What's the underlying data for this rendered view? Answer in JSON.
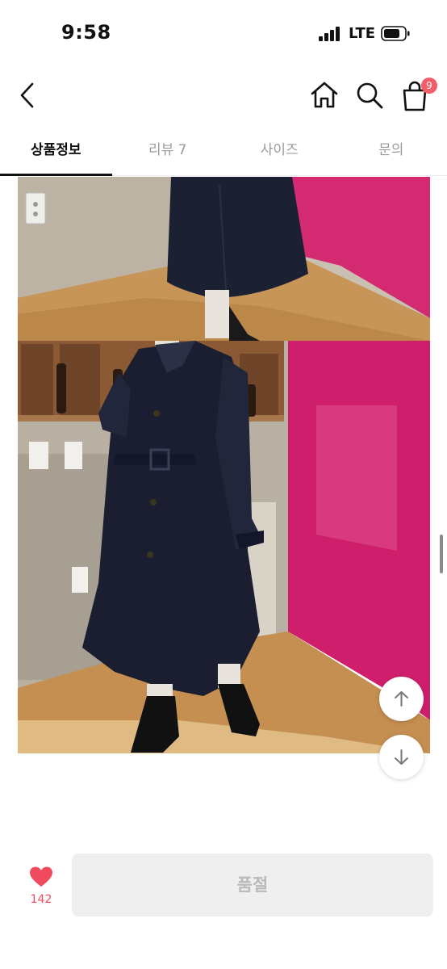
{
  "status_bar": {
    "time": "9:58",
    "carrier": "LTE"
  },
  "header": {
    "icons": {
      "back": "chevron-left-icon",
      "home": "home-icon",
      "search": "search-icon",
      "cart": "shopping-bag-icon"
    },
    "cart_badge": "9",
    "colors": {
      "badge": "#f25d6a"
    }
  },
  "tabs": [
    {
      "label": "상품정보",
      "active": true
    },
    {
      "label": "리뷰 7",
      "active": false
    },
    {
      "label": "사이즈",
      "active": false
    },
    {
      "label": "문의",
      "active": false
    }
  ],
  "floating_buttons": {
    "up_icon": "arrow-up-icon",
    "down_icon": "arrow-down-icon"
  },
  "bottom_bar": {
    "like_icon": "heart-icon",
    "like_count": "142",
    "soldout_label": "품절",
    "colors": {
      "heart": "#f04a5e"
    }
  }
}
